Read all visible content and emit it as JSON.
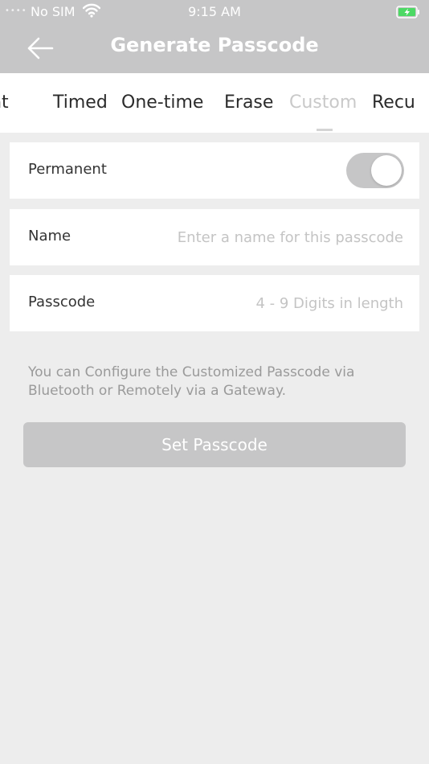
{
  "status_bar": {
    "signal": "••••",
    "carrier": "No SIM",
    "time": "9:15 AM",
    "wifi_icon": "wifi-icon",
    "battery_icon": "battery-charging-icon"
  },
  "header": {
    "title": "Generate Passcode",
    "back_icon": "arrow-left-icon"
  },
  "tabs": [
    {
      "label": "Permanent"
    },
    {
      "label": "Timed"
    },
    {
      "label": "One-time"
    },
    {
      "label": "Erase"
    },
    {
      "label": "Custom",
      "active": true
    },
    {
      "label": "Recurring"
    }
  ],
  "form": {
    "permanent": {
      "label": "Permanent",
      "enabled": true
    },
    "name": {
      "label": "Name",
      "value": "",
      "placeholder": "Enter a name for this passcode"
    },
    "passcode": {
      "label": "Passcode",
      "value": "",
      "placeholder": "4 - 9 Digits in length"
    }
  },
  "info": "You can Configure the Customized Passcode via Bluetooth or Remotely via a Gateway.",
  "actions": {
    "set_passcode": "Set Passcode"
  },
  "colors": {
    "header_bg": "#c6c6c7",
    "page_bg": "#ededed",
    "active_tab": "#c9c9c9",
    "text": "#333333"
  }
}
